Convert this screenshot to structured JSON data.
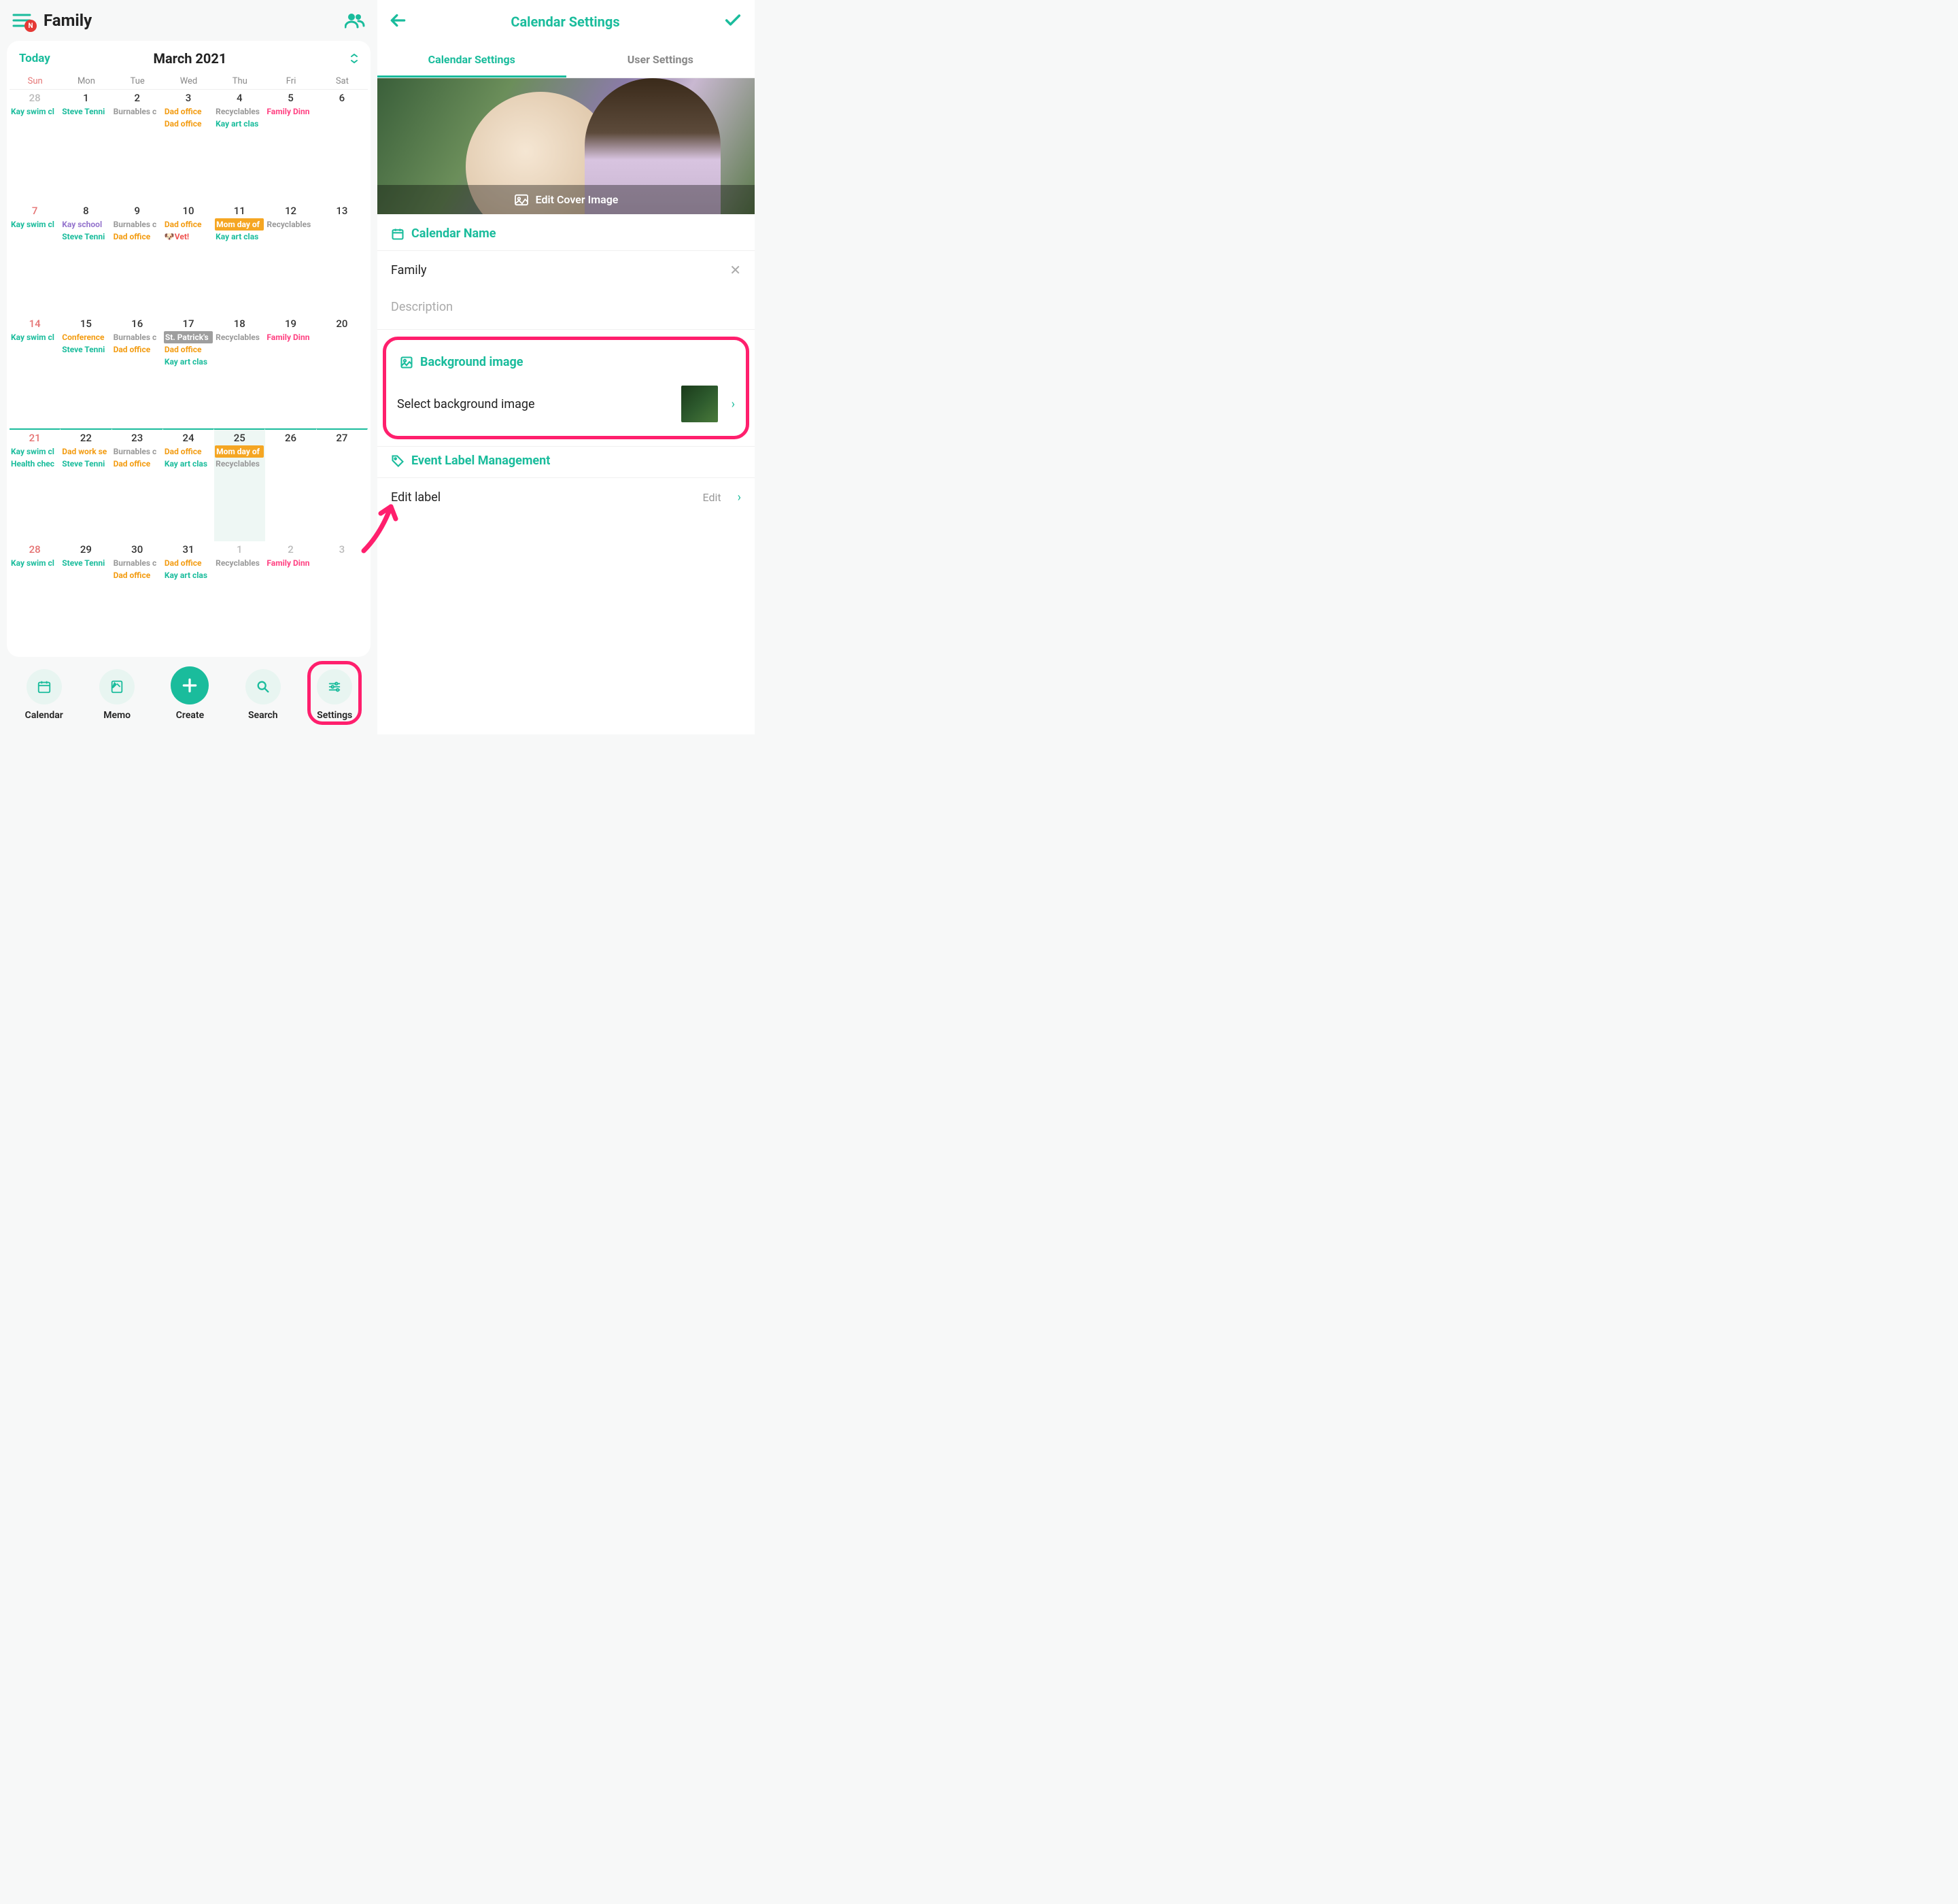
{
  "left": {
    "title": "Family",
    "notification_badge": "N",
    "today_label": "Today",
    "month_label": "March 2021",
    "dow": [
      "Sun",
      "Mon",
      "Tue",
      "Wed",
      "Thu",
      "Fri",
      "Sat"
    ],
    "weeks": [
      [
        {
          "n": "28",
          "cls": "sun other",
          "events": [
            {
              "t": "Kay swim cl",
              "c": "c-teal"
            }
          ]
        },
        {
          "n": "1",
          "events": [
            {
              "t": "Steve Tenni",
              "c": "c-teal"
            }
          ]
        },
        {
          "n": "2",
          "events": [
            {
              "t": "Burnables c",
              "c": "c-grey"
            }
          ]
        },
        {
          "n": "3",
          "events": [
            {
              "t": "Dad office",
              "c": "c-orange"
            },
            {
              "t": "Dad office",
              "c": "c-orange"
            }
          ]
        },
        {
          "n": "4",
          "events": [
            {
              "t": "Recyclables",
              "c": "c-grey"
            },
            {
              "t": "Kay art clas",
              "c": "c-teal"
            }
          ]
        },
        {
          "n": "5",
          "events": [
            {
              "t": "Family Dinn",
              "c": "c-pink"
            }
          ]
        },
        {
          "n": "6",
          "events": []
        }
      ],
      [
        {
          "n": "7",
          "cls": "sun",
          "events": [
            {
              "t": "Kay swim cl",
              "c": "c-teal"
            }
          ]
        },
        {
          "n": "8",
          "events": [
            {
              "t": "Kay school",
              "c": "c-purple"
            },
            {
              "t": "Steve Tenni",
              "c": "c-teal"
            }
          ]
        },
        {
          "n": "9",
          "events": [
            {
              "t": "Burnables c",
              "c": "c-grey"
            },
            {
              "t": "Dad office",
              "c": "c-orange"
            }
          ]
        },
        {
          "n": "10",
          "events": [
            {
              "t": "Dad office",
              "c": "c-orange"
            },
            {
              "t": "🐶Vet!",
              "c": "c-red"
            }
          ]
        },
        {
          "n": "11",
          "events": [
            {
              "t": "Mom day of",
              "c": "bg-orange"
            },
            {
              "t": "Kay art clas",
              "c": "c-teal"
            }
          ]
        },
        {
          "n": "12",
          "events": [
            {
              "t": "Recyclables",
              "c": "c-grey"
            }
          ]
        },
        {
          "n": "13",
          "events": []
        }
      ],
      [
        {
          "n": "14",
          "cls": "sun",
          "events": [
            {
              "t": "Kay swim cl",
              "c": "c-teal"
            }
          ]
        },
        {
          "n": "15",
          "events": [
            {
              "t": "Conference",
              "c": "c-orange"
            },
            {
              "t": "Steve Tenni",
              "c": "c-teal"
            }
          ]
        },
        {
          "n": "16",
          "events": [
            {
              "t": "Burnables c",
              "c": "c-grey"
            },
            {
              "t": "Dad office",
              "c": "c-orange"
            }
          ]
        },
        {
          "n": "17",
          "events": [
            {
              "t": "St. Patrick's",
              "c": "bg-grey"
            },
            {
              "t": "Dad office",
              "c": "c-orange"
            },
            {
              "t": "Kay art clas",
              "c": "c-teal"
            }
          ]
        },
        {
          "n": "18",
          "events": [
            {
              "t": "Recyclables",
              "c": "c-grey"
            }
          ]
        },
        {
          "n": "19",
          "events": [
            {
              "t": "Family Dinn",
              "c": "c-pink"
            }
          ]
        },
        {
          "n": "20",
          "events": []
        }
      ],
      [
        {
          "n": "21",
          "cls": "sun",
          "today_row": true,
          "events": [
            {
              "t": "Kay swim cl",
              "c": "c-teal"
            },
            {
              "t": "Health chec",
              "c": "c-teal"
            }
          ]
        },
        {
          "n": "22",
          "events": [
            {
              "t": "Dad work se",
              "c": "c-orange"
            },
            {
              "t": "Steve Tenni",
              "c": "c-teal"
            }
          ]
        },
        {
          "n": "23",
          "events": [
            {
              "t": "Burnables c",
              "c": "c-grey"
            },
            {
              "t": "Dad office",
              "c": "c-orange"
            }
          ]
        },
        {
          "n": "24",
          "events": [
            {
              "t": "Dad office",
              "c": "c-orange"
            },
            {
              "t": "Kay art clas",
              "c": "c-teal"
            }
          ]
        },
        {
          "n": "25",
          "today": true,
          "events": [
            {
              "t": "Mom day of",
              "c": "bg-orange"
            },
            {
              "t": "Recyclables",
              "c": "c-grey"
            }
          ]
        },
        {
          "n": "26",
          "events": []
        },
        {
          "n": "27",
          "events": []
        }
      ],
      [
        {
          "n": "28",
          "cls": "sun",
          "events": [
            {
              "t": "Kay swim cl",
              "c": "c-teal"
            }
          ]
        },
        {
          "n": "29",
          "events": [
            {
              "t": "Steve Tenni",
              "c": "c-teal"
            }
          ]
        },
        {
          "n": "30",
          "events": [
            {
              "t": "Burnables c",
              "c": "c-grey"
            },
            {
              "t": "Dad office",
              "c": "c-orange"
            }
          ]
        },
        {
          "n": "31",
          "events": [
            {
              "t": "Dad office",
              "c": "c-orange"
            },
            {
              "t": "Kay art clas",
              "c": "c-teal"
            }
          ]
        },
        {
          "n": "1",
          "cls": "other",
          "events": [
            {
              "t": "Recyclables",
              "c": "c-grey"
            }
          ]
        },
        {
          "n": "2",
          "cls": "other",
          "events": [
            {
              "t": "Family Dinn",
              "c": "c-pink"
            }
          ]
        },
        {
          "n": "3",
          "cls": "other",
          "events": []
        }
      ]
    ],
    "nav": {
      "calendar": "Calendar",
      "memo": "Memo",
      "create": "Create",
      "search": "Search",
      "settings": "Settings"
    }
  },
  "right": {
    "title": "Calendar Settings",
    "tabs": {
      "calendar": "Calendar Settings",
      "user": "User Settings"
    },
    "cover_action": "Edit Cover Image",
    "calendar_name": {
      "header": "Calendar Name",
      "value": "Family",
      "desc_placeholder": "Description"
    },
    "background": {
      "header": "Background image",
      "row_label": "Select background image"
    },
    "label_mgmt": {
      "header": "Event Label Management",
      "row_label": "Edit label",
      "action": "Edit"
    }
  }
}
